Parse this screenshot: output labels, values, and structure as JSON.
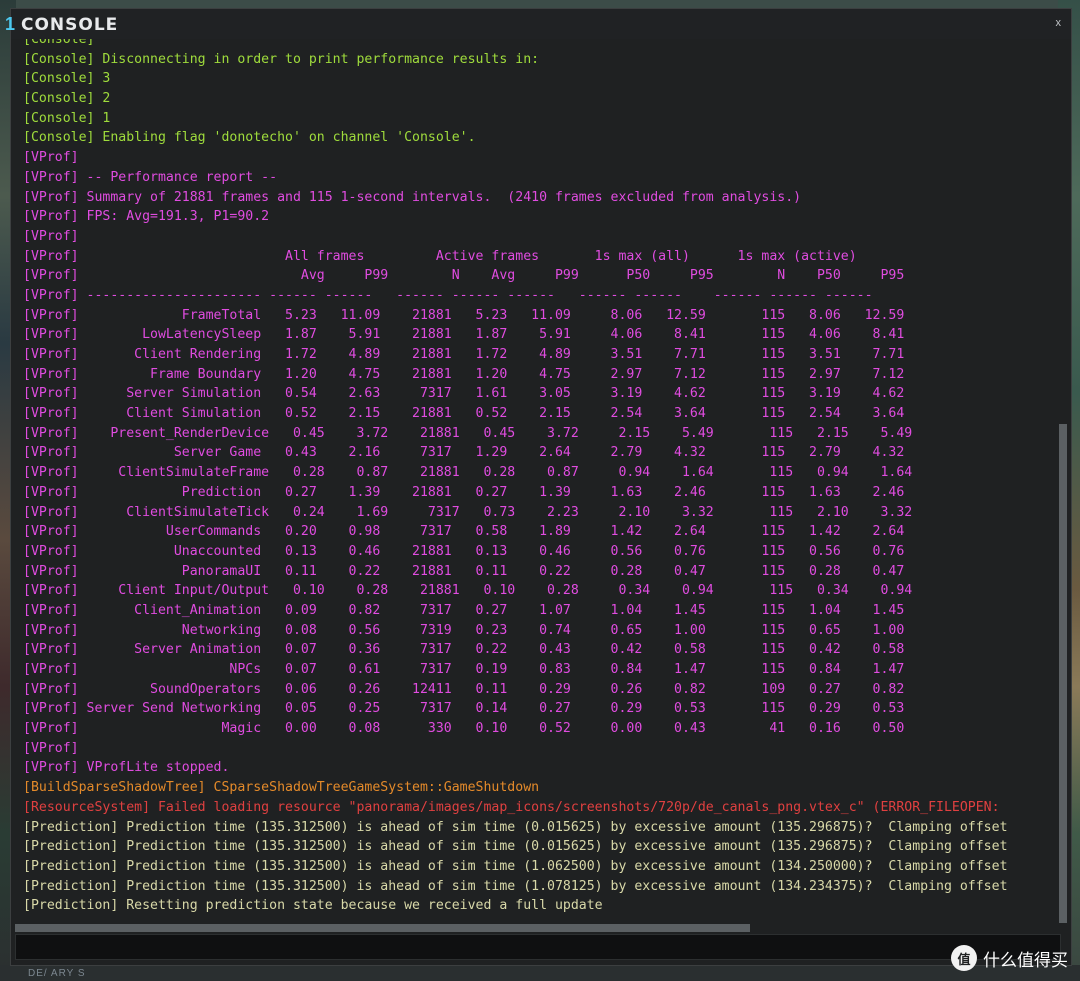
{
  "window": {
    "title": "CONSOLE",
    "title_badge": "1",
    "close_label": "x"
  },
  "background": {
    "bottom_text": "DE/ ARY S"
  },
  "watermark": {
    "icon_glyph": "值",
    "text": "什么值得买"
  },
  "colors": {
    "console": "#9fdc3c",
    "vprof": "#e04ce0",
    "build": "#e48a2a",
    "error": "#e04040",
    "prediction": "#d8d8a8",
    "accent": "#4cc9f0"
  },
  "log": [
    {
      "type": "console",
      "text": "[Console]"
    },
    {
      "type": "console",
      "text": "[Console] Disconnecting in order to print performance results in:"
    },
    {
      "type": "console",
      "text": "[Console] 3"
    },
    {
      "type": "console",
      "text": "[Console] 2"
    },
    {
      "type": "console",
      "text": "[Console] 1"
    },
    {
      "type": "console",
      "text": "[Console] Enabling flag 'donotecho' on channel 'Console'."
    },
    {
      "type": "vprof",
      "text": "[VProf]"
    },
    {
      "type": "vprof",
      "text": "[VProf] -- Performance report --"
    },
    {
      "type": "vprof",
      "text": "[VProf] Summary of 21881 frames and 115 1-second intervals.  (2410 frames excluded from analysis.)"
    },
    {
      "type": "vprof",
      "text": "[VProf] FPS: Avg=191.3, P1=90.2"
    },
    {
      "type": "vprof",
      "text": "[VProf]"
    },
    {
      "type": "vprof",
      "text": "[VProf]                          All frames         Active frames       1s max (all)      1s max (active)"
    },
    {
      "type": "vprof",
      "text": "[VProf]                            Avg     P99        N    Avg     P99      P50     P95        N    P50     P95"
    },
    {
      "type": "vprof",
      "text": "[VProf] ---------------------- ------ ------   ------ ------ ------   ------ ------    ------ ------ ------"
    },
    {
      "type": "vprof",
      "text": "[VProf]             FrameTotal   5.23   11.09    21881   5.23   11.09     8.06   12.59       115   8.06   12.59"
    },
    {
      "type": "vprof",
      "text": "[VProf]        LowLatencySleep   1.87    5.91    21881   1.87    5.91     4.06    8.41       115   4.06    8.41"
    },
    {
      "type": "vprof",
      "text": "[VProf]       Client Rendering   1.72    4.89    21881   1.72    4.89     3.51    7.71       115   3.51    7.71"
    },
    {
      "type": "vprof",
      "text": "[VProf]         Frame Boundary   1.20    4.75    21881   1.20    4.75     2.97    7.12       115   2.97    7.12"
    },
    {
      "type": "vprof",
      "text": "[VProf]      Server Simulation   0.54    2.63     7317   1.61    3.05     3.19    4.62       115   3.19    4.62"
    },
    {
      "type": "vprof",
      "text": "[VProf]      Client Simulation   0.52    2.15    21881   0.52    2.15     2.54    3.64       115   2.54    3.64"
    },
    {
      "type": "vprof",
      "text": "[VProf]    Present_RenderDevice   0.45    3.72    21881   0.45    3.72     2.15    5.49       115   2.15    5.49"
    },
    {
      "type": "vprof",
      "text": "[VProf]            Server Game   0.43    2.16     7317   1.29    2.64     2.79    4.32       115   2.79    4.32"
    },
    {
      "type": "vprof",
      "text": "[VProf]     ClientSimulateFrame   0.28    0.87    21881   0.28    0.87     0.94    1.64       115   0.94    1.64"
    },
    {
      "type": "vprof",
      "text": "[VProf]             Prediction   0.27    1.39    21881   0.27    1.39     1.63    2.46       115   1.63    2.46"
    },
    {
      "type": "vprof",
      "text": "[VProf]      ClientSimulateTick   0.24    1.69     7317   0.73    2.23     2.10    3.32       115   2.10    3.32"
    },
    {
      "type": "vprof",
      "text": "[VProf]           UserCommands   0.20    0.98     7317   0.58    1.89     1.42    2.64       115   1.42    2.64"
    },
    {
      "type": "vprof",
      "text": "[VProf]            Unaccounted   0.13    0.46    21881   0.13    0.46     0.56    0.76       115   0.56    0.76"
    },
    {
      "type": "vprof",
      "text": "[VProf]             PanoramaUI   0.11    0.22    21881   0.11    0.22     0.28    0.47       115   0.28    0.47"
    },
    {
      "type": "vprof",
      "text": "[VProf]     Client Input/Output   0.10    0.28    21881   0.10    0.28     0.34    0.94       115   0.34    0.94"
    },
    {
      "type": "vprof",
      "text": "[VProf]       Client_Animation   0.09    0.82     7317   0.27    1.07     1.04    1.45       115   1.04    1.45"
    },
    {
      "type": "vprof",
      "text": "[VProf]             Networking   0.08    0.56     7319   0.23    0.74     0.65    1.00       115   0.65    1.00"
    },
    {
      "type": "vprof",
      "text": "[VProf]       Server Animation   0.07    0.36     7317   0.22    0.43     0.42    0.58       115   0.42    0.58"
    },
    {
      "type": "vprof",
      "text": "[VProf]                   NPCs   0.07    0.61     7317   0.19    0.83     0.84    1.47       115   0.84    1.47"
    },
    {
      "type": "vprof",
      "text": "[VProf]         SoundOperators   0.06    0.26    12411   0.11    0.29     0.26    0.82       109   0.27    0.82"
    },
    {
      "type": "vprof",
      "text": "[VProf] Server Send Networking   0.05    0.25     7317   0.14    0.27     0.29    0.53       115   0.29    0.53"
    },
    {
      "type": "vprof",
      "text": "[VProf]                  Magic   0.00    0.08      330   0.10    0.52     0.00    0.43        41   0.16    0.50"
    },
    {
      "type": "vprof",
      "text": "[VProf]"
    },
    {
      "type": "vprof",
      "text": "[VProf] VProfLite stopped."
    },
    {
      "type": "build",
      "text": "[BuildSparseShadowTree] CSparseShadowTreeGameSystem::GameShutdown"
    },
    {
      "type": "error",
      "text": "[ResourceSystem] Failed loading resource \"panorama/images/map_icons/screenshots/720p/de_canals_png.vtex_c\" (ERROR_FILEOPEN:"
    },
    {
      "type": "pred",
      "text": "[Prediction] Prediction time (135.312500) is ahead of sim time (0.015625) by excessive amount (135.296875)?  Clamping offset"
    },
    {
      "type": "pred",
      "text": "[Prediction] Prediction time (135.312500) is ahead of sim time (0.015625) by excessive amount (135.296875)?  Clamping offset"
    },
    {
      "type": "pred",
      "text": "[Prediction] Prediction time (135.312500) is ahead of sim time (1.062500) by excessive amount (134.250000)?  Clamping offset"
    },
    {
      "type": "pred",
      "text": "[Prediction] Prediction time (135.312500) is ahead of sim time (1.078125) by excessive amount (134.234375)?  Clamping offset"
    },
    {
      "type": "pred",
      "text": "[Prediction] Resetting prediction state because we received a full update"
    }
  ],
  "input": {
    "value": "",
    "placeholder": ""
  }
}
